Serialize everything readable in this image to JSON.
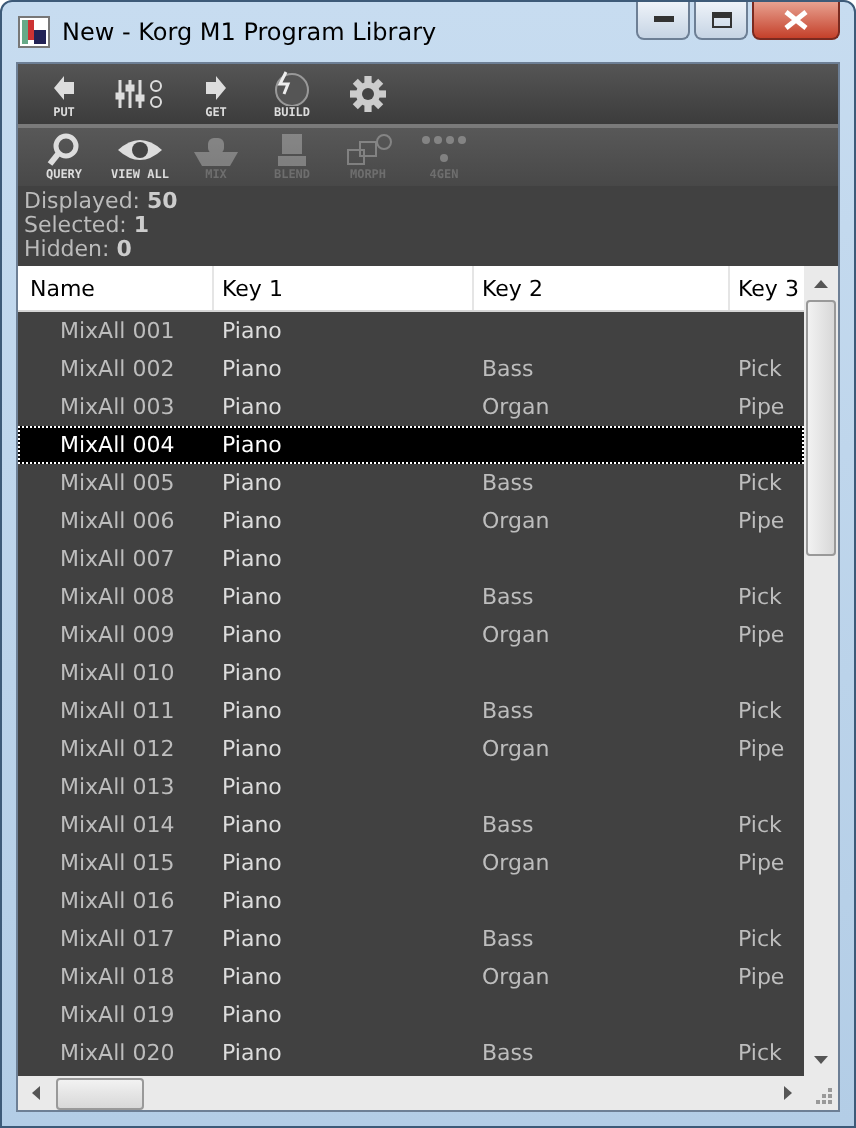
{
  "window": {
    "title": "New - Korg M1 Program Library"
  },
  "toolbar": [
    {
      "kind": "put",
      "label": "PUT",
      "disabled": false
    },
    {
      "kind": "mixer",
      "disabled": false
    },
    {
      "kind": "get",
      "label": "GET",
      "disabled": false
    },
    {
      "kind": "build",
      "label": "BUILD",
      "disabled": false
    },
    {
      "kind": "gear",
      "disabled": false
    }
  ],
  "toolbar_2": [
    {
      "kind": "query",
      "label": "QUERY",
      "disabled": false
    },
    {
      "kind": "eye",
      "label": "VIEW ALL",
      "disabled": false
    },
    {
      "kind": "mix",
      "label": "MIX",
      "disabled": true
    },
    {
      "kind": "blend",
      "label": "BLEND",
      "disabled": true
    },
    {
      "kind": "morph",
      "label": "MORPH",
      "disabled": true
    },
    {
      "kind": "gen",
      "label": "4GEN",
      "disabled": true
    }
  ],
  "stats": [
    {
      "label": "Displayed:",
      "value": "50"
    },
    {
      "label": "Selected:",
      "value": "1"
    },
    {
      "label": "Hidden:",
      "value": "0"
    }
  ],
  "table": {
    "columns": [
      "Name",
      "Key 1",
      "Key 2",
      "Key 3"
    ],
    "rows": [
      {
        "cells": [
          "MixAll 001",
          "Piano",
          "",
          ""
        ],
        "selected": false
      },
      {
        "cells": [
          "MixAll 002",
          "Piano",
          "Bass",
          "Pick"
        ],
        "selected": false
      },
      {
        "cells": [
          "MixAll 003",
          "Piano",
          "Organ",
          "Pipe"
        ],
        "selected": false
      },
      {
        "cells": [
          "MixAll 004",
          "Piano",
          "",
          ""
        ],
        "selected": true
      },
      {
        "cells": [
          "MixAll 005",
          "Piano",
          "Bass",
          "Pick"
        ],
        "selected": false
      },
      {
        "cells": [
          "MixAll 006",
          "Piano",
          "Organ",
          "Pipe"
        ],
        "selected": false
      },
      {
        "cells": [
          "MixAll 007",
          "Piano",
          "",
          ""
        ],
        "selected": false
      },
      {
        "cells": [
          "MixAll 008",
          "Piano",
          "Bass",
          "Pick"
        ],
        "selected": false
      },
      {
        "cells": [
          "MixAll 009",
          "Piano",
          "Organ",
          "Pipe"
        ],
        "selected": false
      },
      {
        "cells": [
          "MixAll 010",
          "Piano",
          "",
          ""
        ],
        "selected": false
      },
      {
        "cells": [
          "MixAll 011",
          "Piano",
          "Bass",
          "Pick"
        ],
        "selected": false
      },
      {
        "cells": [
          "MixAll 012",
          "Piano",
          "Organ",
          "Pipe"
        ],
        "selected": false
      },
      {
        "cells": [
          "MixAll 013",
          "Piano",
          "",
          ""
        ],
        "selected": false
      },
      {
        "cells": [
          "MixAll 014",
          "Piano",
          "Bass",
          "Pick"
        ],
        "selected": false
      },
      {
        "cells": [
          "MixAll 015",
          "Piano",
          "Organ",
          "Pipe"
        ],
        "selected": false
      },
      {
        "cells": [
          "MixAll 016",
          "Piano",
          "",
          ""
        ],
        "selected": false
      },
      {
        "cells": [
          "MixAll 017",
          "Piano",
          "Bass",
          "Pick"
        ],
        "selected": false
      },
      {
        "cells": [
          "MixAll 018",
          "Piano",
          "Organ",
          "Pipe"
        ],
        "selected": false
      },
      {
        "cells": [
          "MixAll 019",
          "Piano",
          "",
          ""
        ],
        "selected": false
      },
      {
        "cells": [
          "MixAll 020",
          "Piano",
          "Bass",
          "Pick"
        ],
        "selected": false
      }
    ]
  }
}
